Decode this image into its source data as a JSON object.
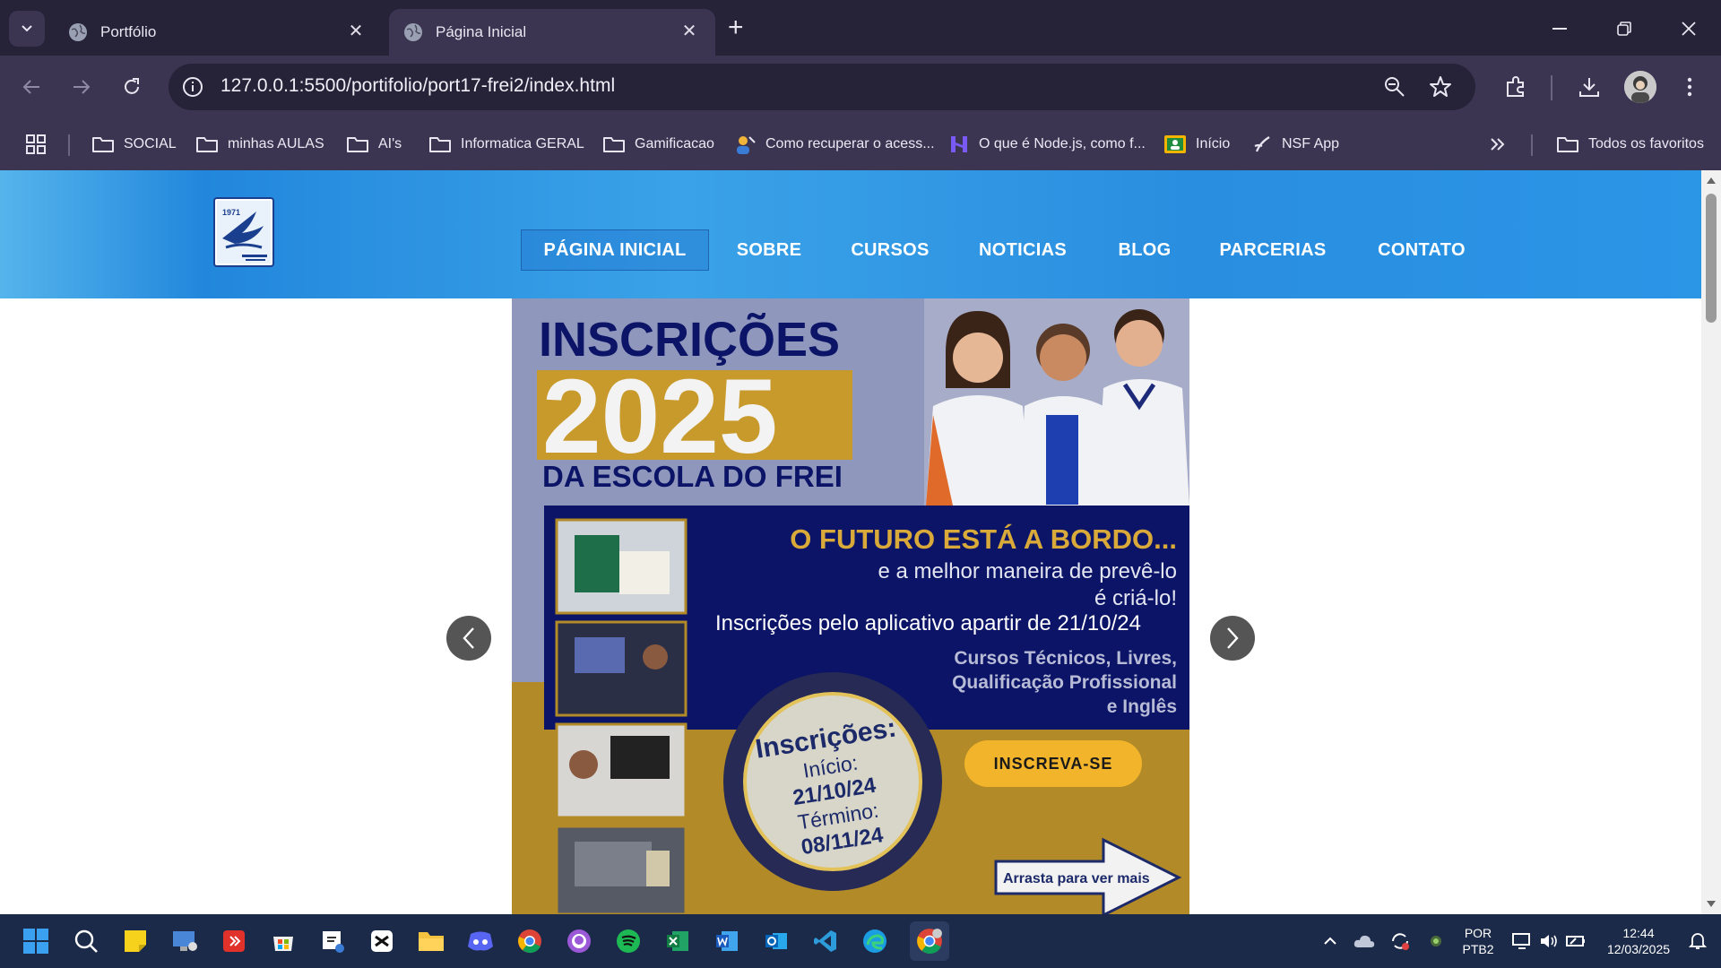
{
  "browser": {
    "tabs": [
      {
        "title": "Portfólio",
        "active": false
      },
      {
        "title": "Página Inicial",
        "active": true
      }
    ],
    "url": "127.0.0.1:5500/portifolio/port17-frei2/index.html",
    "bookmarks": [
      {
        "label": "SOCIAL",
        "icon": "folder-icon"
      },
      {
        "label": "minhas AULAS",
        "icon": "folder-icon"
      },
      {
        "label": "AI's",
        "icon": "folder-icon"
      },
      {
        "label": "Informatica GERAL",
        "icon": "folder-icon"
      },
      {
        "label": "Gamificacao",
        "icon": "folder-icon"
      },
      {
        "label": "Como recuperar o acess...",
        "icon": "site-icon"
      },
      {
        "label": "O que é Node.js, como f...",
        "icon": "site-icon"
      },
      {
        "label": "Início",
        "icon": "site-icon"
      },
      {
        "label": "NSF App",
        "icon": "site-icon"
      }
    ],
    "all_bookmarks": "Todos os favoritos",
    "colors": {
      "tabstrip": "#262238",
      "toolbar": "#3b3552"
    }
  },
  "site": {
    "nav": [
      "PÁGINA INICIAL",
      "SOBRE",
      "CURSOS",
      "NOTICIAS",
      "BLOG",
      "PARCERIAS",
      "CONTATO"
    ],
    "active_nav": "PÁGINA INICIAL",
    "logo_text": "1971",
    "banner": {
      "headline": "INSCRIÇÕES",
      "year": "2025",
      "subheadline": "DA ESCOLA DO FREI",
      "tagline": "O FUTURO ESTÁ A BORDO...",
      "quote_line1": "e a melhor maneira de prevê-lo",
      "quote_line2": "é criá-lo!",
      "app_note": "Inscrições pelo aplicativo apartir de 21/10/24",
      "courses_line1": "Cursos Técnicos, Livres,",
      "courses_line2": "Qualificação Profissional",
      "courses_line3": "e Inglês",
      "badge_title": "Inscrições:",
      "badge_start_label": "Início:",
      "badge_start_date": "21/10/24",
      "badge_end_label": "Término:",
      "badge_end_date": "08/11/24",
      "cta": "INSCREVA-SE",
      "swipe_hint": "Arrasta para ver mais"
    }
  },
  "taskbar": {
    "lang_line1": "POR",
    "lang_line2": "PTB2",
    "time": "12:44",
    "date": "12/03/2025"
  }
}
